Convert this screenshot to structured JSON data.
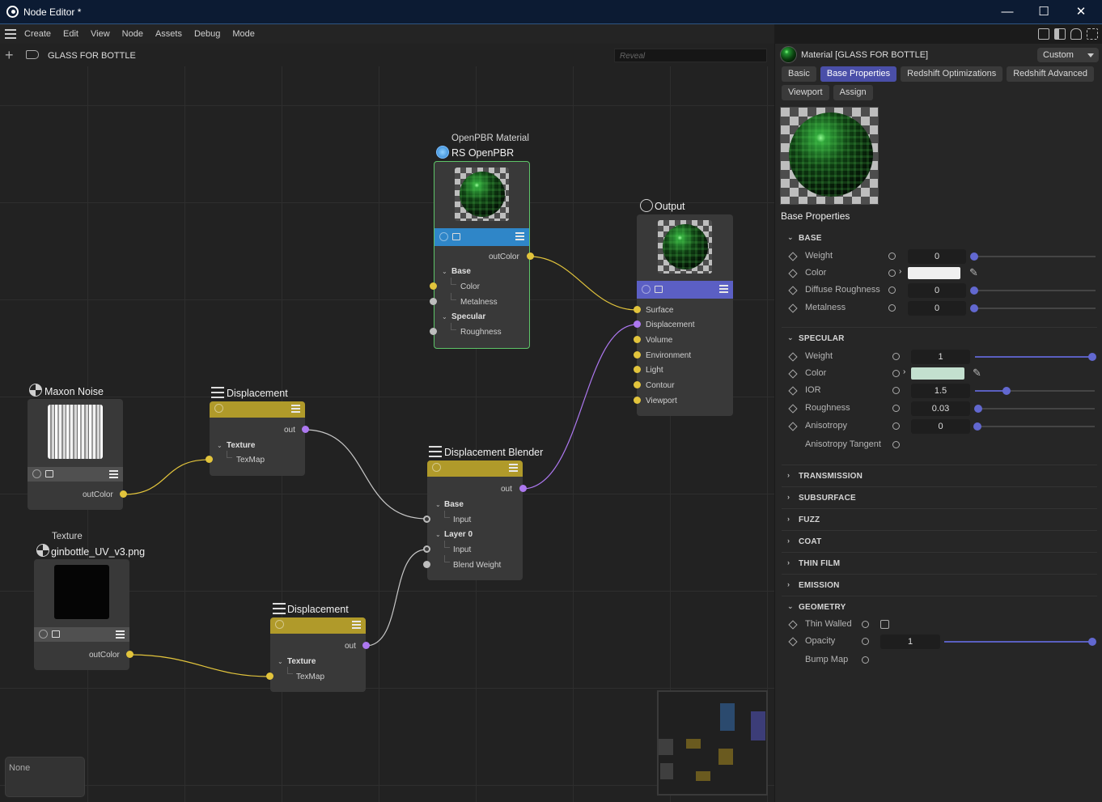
{
  "window": {
    "title": "Node Editor *",
    "minimize": "—",
    "maximize": "☐",
    "close": "✕"
  },
  "menu": [
    "Create",
    "Edit",
    "View",
    "Node",
    "Assets",
    "Debug",
    "Mode"
  ],
  "header": {
    "material_name": "GLASS FOR BOTTLE",
    "reveal_placeholder": "Reveal"
  },
  "nodes": {
    "openpbr": {
      "type": "OpenPBR Material",
      "name": "RS OpenPBR",
      "out": "outColor",
      "group_base": "Base",
      "color": "Color",
      "metalness": "Metalness",
      "group_specular": "Specular",
      "roughness": "Roughness"
    },
    "output": {
      "name": "Output",
      "ports": [
        "Surface",
        "Displacement",
        "Volume",
        "Environment",
        "Light",
        "Contour",
        "Viewport"
      ]
    },
    "noise": {
      "name": "Maxon Noise",
      "out": "outColor"
    },
    "disp1": {
      "name": "Displacement",
      "out": "out",
      "group": "Texture",
      "input": "TexMap"
    },
    "blender": {
      "name": "Displacement Blender",
      "out": "out",
      "group_base": "Base",
      "base_input": "Input",
      "group_layer": "Layer 0",
      "layer_input": "Input",
      "blend_weight": "Blend Weight"
    },
    "texture": {
      "type": "Texture",
      "name": "ginbottle_UV_v3.png",
      "out": "outColor"
    },
    "disp2": {
      "name": "Displacement",
      "out": "out",
      "group": "Texture",
      "input": "TexMap"
    }
  },
  "status": {
    "text": "None"
  },
  "colors": {
    "accent": "#4a4fa8",
    "wire_color": "#e2c43c",
    "wire_vector": "#ad78f0",
    "openpbr_header": "#2f86c8",
    "output_header": "#5b5fc4",
    "disp_header": "#b09a2a",
    "texture_header": "#505050"
  },
  "attributes": {
    "title": "Material [GLASS FOR BOTTLE]",
    "layout_mode": "Custom",
    "tabs": [
      "Basic",
      "Base Properties",
      "Redshift Optimizations",
      "Redshift Advanced",
      "Viewport",
      "Assign"
    ],
    "active_tab": "Base Properties",
    "section_title": "Base Properties",
    "base": {
      "title": "BASE",
      "weight": {
        "label": "Weight",
        "value": "0",
        "level": 0
      },
      "color": {
        "label": "Color",
        "value": "#f0f0f0"
      },
      "diffuse_roughness": {
        "label": "Diffuse Roughness",
        "value": "0",
        "level": 0
      },
      "metalness": {
        "label": "Metalness",
        "value": "0",
        "level": 0
      }
    },
    "specular": {
      "title": "SPECULAR",
      "weight": {
        "label": "Weight",
        "value": "1",
        "level": 1
      },
      "color": {
        "label": "Color",
        "value": "#c3e0cf"
      },
      "ior": {
        "label": "IOR",
        "value": "1.5",
        "level": 0.27
      },
      "roughness": {
        "label": "Roughness",
        "value": "0.03",
        "level": 0.03
      },
      "anisotropy": {
        "label": "Anisotropy",
        "value": "0",
        "level": 0
      },
      "anisotropy_tangent": {
        "label": "Anisotropy Tangent"
      }
    },
    "collapsed": [
      "TRANSMISSION",
      "SUBSURFACE",
      "FUZZ",
      "COAT",
      "THIN FILM",
      "EMISSION"
    ],
    "geometry": {
      "title": "GEOMETRY",
      "thin_walled": {
        "label": "Thin Walled"
      },
      "opacity": {
        "label": "Opacity",
        "value": "1",
        "level": 1
      },
      "bump_map": {
        "label": "Bump Map"
      }
    }
  }
}
